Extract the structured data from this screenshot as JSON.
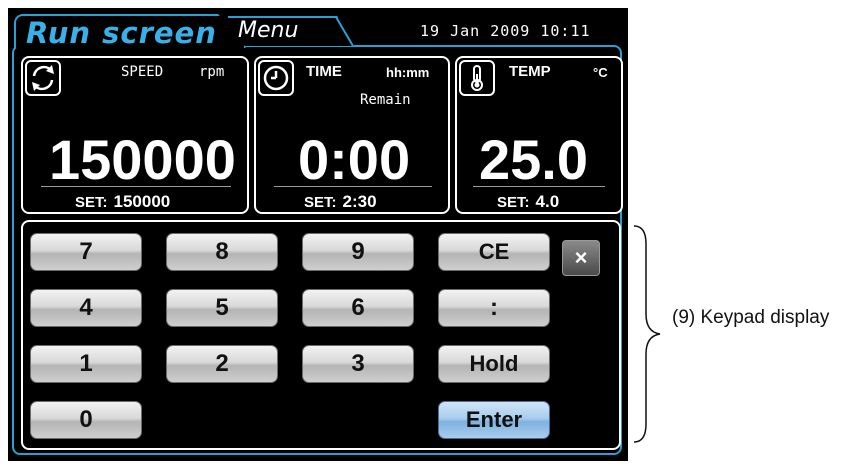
{
  "header": {
    "run_tab_label": "Run screen",
    "menu_tab_label": "Menu",
    "datetime": "19 Jan 2009 10:11"
  },
  "speed_panel": {
    "icon": "rotation-icon",
    "label": "SPEED",
    "unit": "rpm",
    "value": "150000",
    "set_label": "SET:",
    "set_value": "150000"
  },
  "time_panel": {
    "icon": "clock-icon",
    "label": "TIME",
    "unit": "hh:mm",
    "sublabel": "Remain",
    "value": "0:00",
    "set_label": "SET:",
    "set_value": "2:30"
  },
  "temp_panel": {
    "icon": "thermometer-icon",
    "label": "TEMP",
    "unit": "°C",
    "value": "25.0",
    "set_label": "SET:",
    "set_value": "4.0"
  },
  "keypad": {
    "k7": "7",
    "k8": "8",
    "k9": "9",
    "ce": "CE",
    "k4": "4",
    "k5": "5",
    "k6": "6",
    "colon": ":",
    "k1": "1",
    "k2": "2",
    "k3": "3",
    "hold": "Hold",
    "k0": "0",
    "enter": "Enter",
    "close": "×"
  },
  "annotation": {
    "label": "(9) Keypad display"
  },
  "colors": {
    "accent": "#2a9fd6",
    "screen_bg": "#000000",
    "key_face": "#d0d0d0",
    "enter_face": "#a8cdee"
  }
}
